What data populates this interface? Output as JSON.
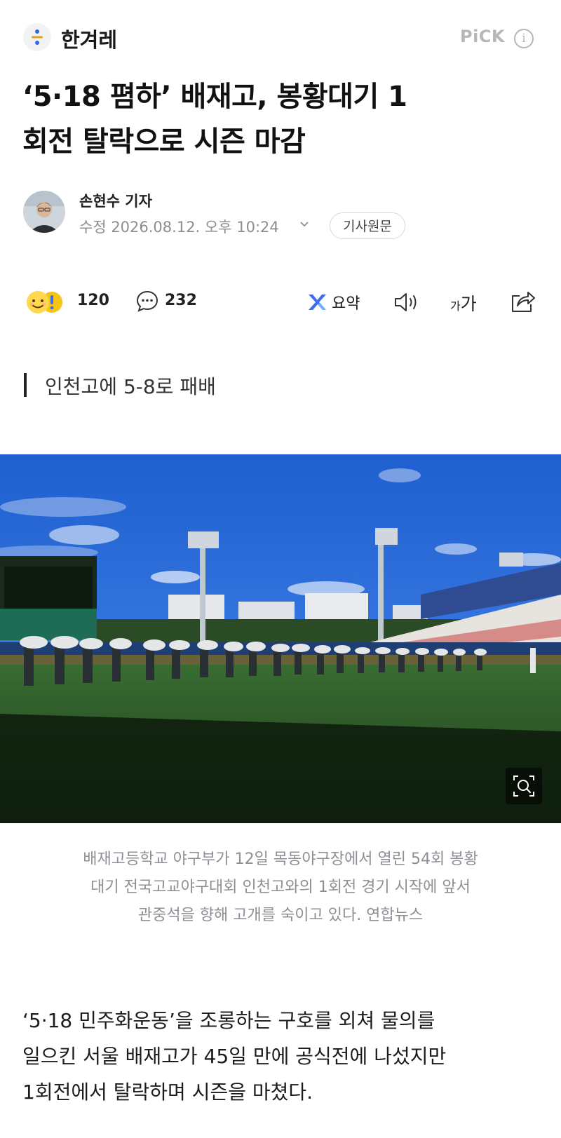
{
  "header": {
    "publisher": "한겨레",
    "pick_label": "PiCK",
    "info_icon": "info-icon"
  },
  "article": {
    "title_line1": "‘5·18 폄하’ 배재고, 봉황대기 1",
    "title_line2": "회전 탈락으로 시즌 마감",
    "reporter": "손현수 기자",
    "modified": "수정 2026.08.12. 오후 10:24",
    "original_button": "기사원문"
  },
  "actions": {
    "reactions_count": "120",
    "comments_count": "232",
    "summary_label": "요약",
    "font_small": "가",
    "font_big": "가"
  },
  "subheading": "인천고에 5-8로 패배",
  "photo": {
    "caption_line1": "배재고등학교 야구부가 12일 목동야구장에서 열린 54회 봉황",
    "caption_line2": "대기 전국고교야구대회 인천고와의 1회전 경기 시작에 앞서",
    "caption_line3": "관중석을 향해 고개를 숙이고 있다. 연합뉴스"
  },
  "body": {
    "line1": "‘5·18 민주화운동’을 조롱하는 구호를 외쳐 물의를",
    "line2": "일으킨 서울 배재고가 45일 만에 공식전에 나섰지만",
    "line3": "1회전에서 탈락하며 시즌을 마쳤다."
  },
  "colors": {
    "accent_blue": "#3d6ef0",
    "muted_text": "#8a8d92"
  }
}
